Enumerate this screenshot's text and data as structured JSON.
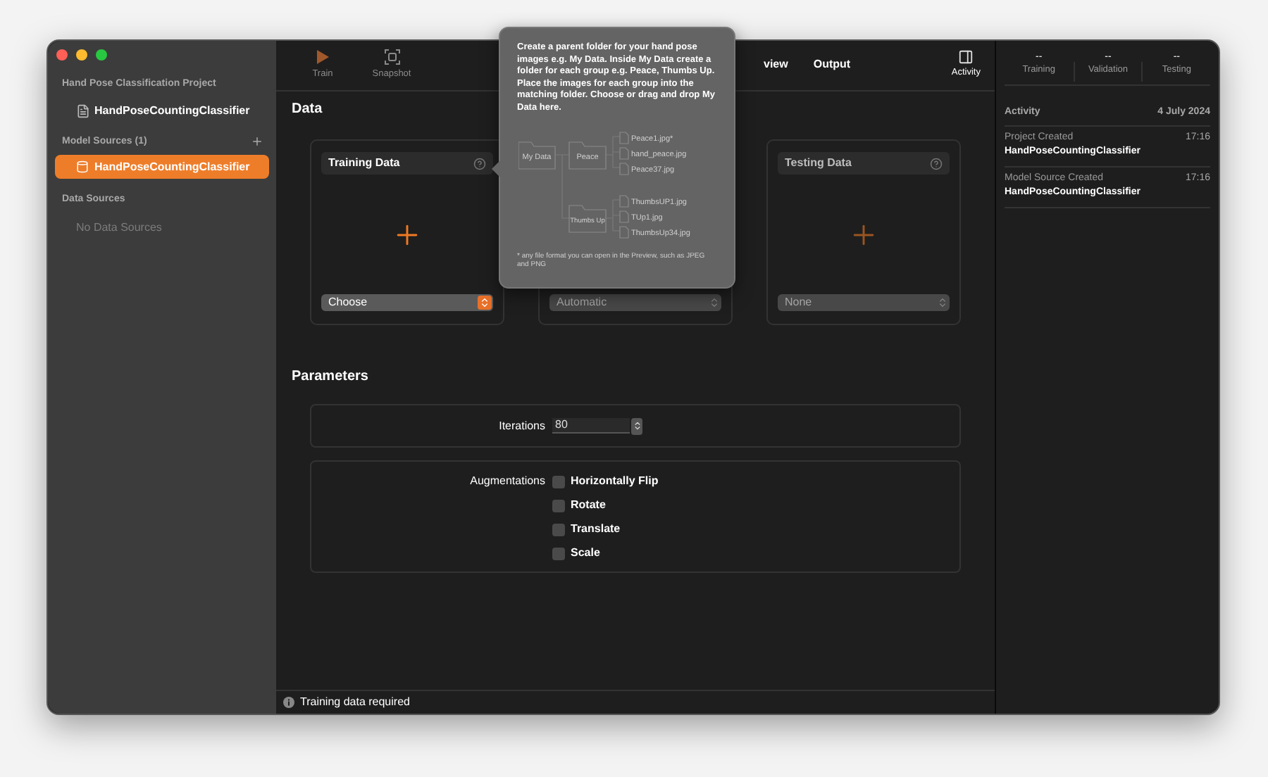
{
  "sidebar": {
    "project_header": "Hand Pose Classification Project",
    "project_item": "HandPoseCountingClassifier",
    "model_sources": {
      "header": "Model Sources (1)",
      "items": [
        {
          "label": "HandPoseCountingClassifier",
          "selected": true
        }
      ]
    },
    "data_sources": {
      "header": "Data Sources",
      "empty": "No Data Sources"
    }
  },
  "toolbar": {
    "buttons": [
      {
        "label": "Train",
        "kind": "train"
      },
      {
        "label": "Snapshot",
        "kind": "snapshot"
      }
    ],
    "tabs": [
      "view",
      "Output"
    ],
    "activity_button": "Activity"
  },
  "data": {
    "title": "Data",
    "cards": [
      {
        "title": "Training Data",
        "popup": "Choose",
        "enabled": true
      },
      {
        "popup": "Automatic",
        "enabled": false
      },
      {
        "title": "Testing Data",
        "popup": "None",
        "enabled": false
      }
    ]
  },
  "parameters": {
    "title": "Parameters",
    "iterations": {
      "label": "Iterations",
      "value": "80"
    },
    "augmentations": {
      "label": "Augmentations",
      "options": [
        {
          "label": "Horizontally Flip",
          "checked": false
        },
        {
          "label": "Rotate",
          "checked": false
        },
        {
          "label": "Translate",
          "checked": false
        },
        {
          "label": "Scale",
          "checked": false
        }
      ]
    }
  },
  "status_bar": "Training data required",
  "activity_pane": {
    "metrics": [
      {
        "value": "--",
        "label": "Training"
      },
      {
        "value": "--",
        "label": "Validation"
      },
      {
        "value": "--",
        "label": "Testing"
      }
    ],
    "header": "Activity",
    "date": "4 July 2024",
    "events": [
      {
        "title": "Project Created",
        "time": "17:16",
        "detail": "HandPoseCountingClassifier"
      },
      {
        "title": "Model Source Created",
        "time": "17:16",
        "detail": "HandPoseCountingClassifier"
      }
    ]
  },
  "popover": {
    "text": "Create a parent folder for your hand pose images e.g. My Data. Inside My Data create a folder for each group e.g. Peace, Thumbs Up. Place the images for each group into the matching folder. Choose or drag and drop My Data here.",
    "diagram": {
      "root": "My Data",
      "folders": [
        {
          "name": "Peace",
          "files": [
            "Peace1.jpg*",
            "hand_peace.jpg",
            "Peace37.jpg"
          ]
        },
        {
          "name": "Thumbs Up",
          "files": [
            "ThumbsUP1.jpg",
            "TUp1.jpg",
            "ThumbsUp34.jpg"
          ]
        }
      ]
    },
    "footnote": "* any file format you can open in the Preview, such as JPEG and PNG"
  }
}
